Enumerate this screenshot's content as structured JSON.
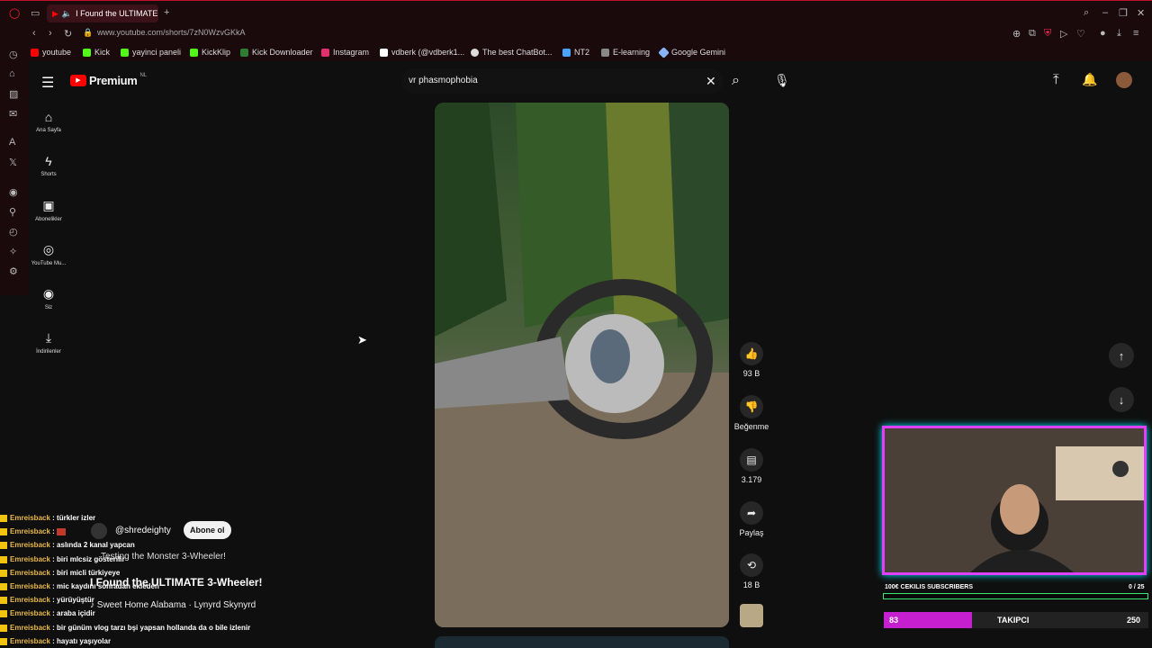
{
  "browser": {
    "tab_title": "I Found the ULTIMATE",
    "url": "www.youtube.com/shorts/7zN0WzvGKkA",
    "bookmarks": [
      {
        "label": "youtube",
        "color": "#ff0000"
      },
      {
        "label": "Kick",
        "color": "#53fc18"
      },
      {
        "label": "yayinci paneli",
        "color": "#53fc18"
      },
      {
        "label": "KickKlip",
        "color": "#53fc18"
      },
      {
        "label": "Kick Downloader",
        "color": "#53fc18"
      },
      {
        "label": "Instagram",
        "color": "#e1306c"
      },
      {
        "label": "vdberk (@vdberk1...",
        "color": "#ffffff"
      },
      {
        "label": "The best ChatBot...",
        "color": "#ffffff"
      },
      {
        "label": "NT2",
        "color": "#4aa3ff"
      },
      {
        "label": "E-learning",
        "color": "#cccccc"
      },
      {
        "label": "Google Gemini",
        "color": "#8ab4f8"
      }
    ]
  },
  "youtube": {
    "logo_label": "Premium",
    "logo_region": "NL",
    "search_value": "vr phasmophobia",
    "sidebar": [
      {
        "label": "Ana Sayfa",
        "icon": "home-icon"
      },
      {
        "label": "Shorts",
        "icon": "shorts-icon"
      },
      {
        "label": "Abonelikler",
        "icon": "subscriptions-icon"
      },
      {
        "label": "YouTube Mu...",
        "icon": "music-icon"
      },
      {
        "label": "Siz",
        "icon": "you-icon"
      },
      {
        "label": "İndirilenler",
        "icon": "download-icon"
      }
    ],
    "actions": {
      "like_count": "93 B",
      "dislike_label": "Beğenme",
      "comment_count": "3.179",
      "share_label": "Paylaş",
      "remix_count": "18 B"
    },
    "short": {
      "channel": "@shredeighty",
      "subscribe_label": "Abone ol",
      "description": "Testing the Monster 3-Wheeler!",
      "title": "I Found the ULTIMATE 3-Wheeler!",
      "music": "Sweet Home Alabama · Lynyrd Skynyrd"
    }
  },
  "chat": [
    {
      "user": "Emreisback",
      "msg": ": türkler izler"
    },
    {
      "user": "Emreisback",
      "msg": ":"
    },
    {
      "user": "Emreisback",
      "msg": ": aslında 2 kanal yapcan"
    },
    {
      "user": "Emreisback",
      "msg": ": biri mlcsiz gösterilir"
    },
    {
      "user": "Emreisback",
      "msg": ": biri micli türkiyeye"
    },
    {
      "user": "Emreisback",
      "msg": ": mic kaydını sonradan ekleden"
    },
    {
      "user": "Emreisback",
      "msg": ": yürüyüştür"
    },
    {
      "user": "Emreisback",
      "msg": ": araba içidir"
    },
    {
      "user": "Emreisback",
      "msg": ": bir günüm vlog tarzı bşi yapsan hollanda da o bile izlenir"
    },
    {
      "user": "Emreisback",
      "msg": ": hayatı yaşıyolar"
    }
  ],
  "overlay": {
    "subs_label": "100€ CEKILIS SUBSCRIBERS",
    "subs_count": "0 / 25",
    "subs_progress": 0.0,
    "followers_current": "83",
    "followers_label": "TAKIPCI",
    "followers_goal": "250",
    "followers_progress": 0.332
  }
}
